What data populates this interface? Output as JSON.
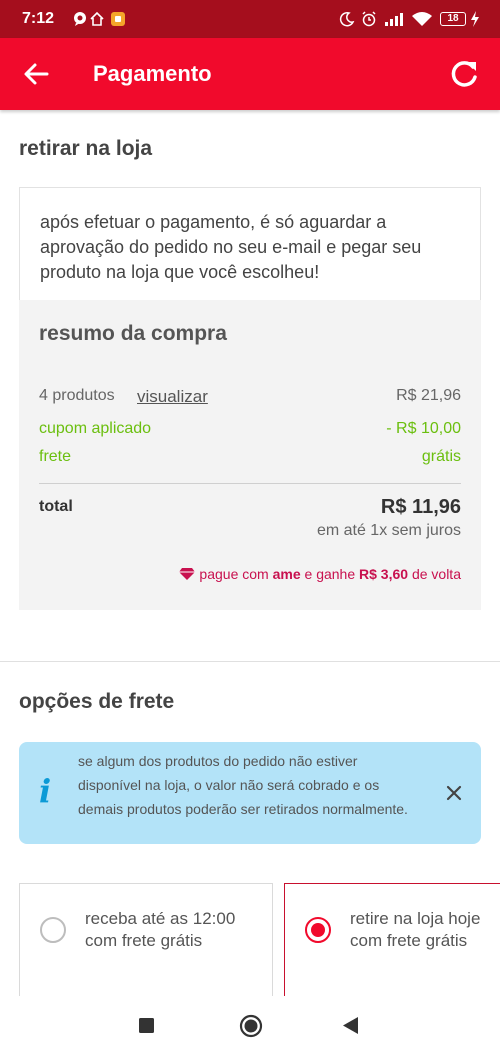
{
  "status_bar": {
    "time": "7:12",
    "battery": "18"
  },
  "app_bar": {
    "title": "Pagamento"
  },
  "pickup": {
    "heading": "retirar na loja",
    "info_text": "após efetuar o pagamento, é só aguardar a aprovação do pedido no seu e-mail e pegar seu produto na loja que você escolheu!"
  },
  "summary": {
    "title": "resumo da compra",
    "products_label": "4 produtos",
    "view_link": "visualizar",
    "products_value": "R$ 21,96",
    "coupon_label": "cupom aplicado",
    "coupon_value": "- R$ 10,00",
    "shipping_label": "frete",
    "shipping_value": "grátis",
    "total_label": "total",
    "total_value": "R$ 11,96",
    "installments": "em até 1x sem juros",
    "ame_prefix": "pague com ",
    "ame_brand": "ame",
    "ame_middle": " e ganhe ",
    "ame_amount": "R$ 3,60",
    "ame_suffix": " de volta"
  },
  "shipping_options": {
    "heading": "opções de frete",
    "notice_icon": "i",
    "notice_text": "se algum dos produtos do pedido não estiver disponível na loja, o valor não será cobrado e os demais produtos poderão ser retirados normalmente.",
    "options": [
      {
        "line1": "receba até as 12:00",
        "line2": "com frete grátis",
        "selected": false
      },
      {
        "line1": "retire na loja hoje",
        "line2": "com frete grátis",
        "selected": true
      }
    ]
  },
  "colors": {
    "brand_red": "#f10a2c",
    "status_bar": "#a50e1d",
    "green": "#6bbf0f",
    "ame_pink": "#c8114f",
    "notice_blue": "#b3e3f8"
  }
}
